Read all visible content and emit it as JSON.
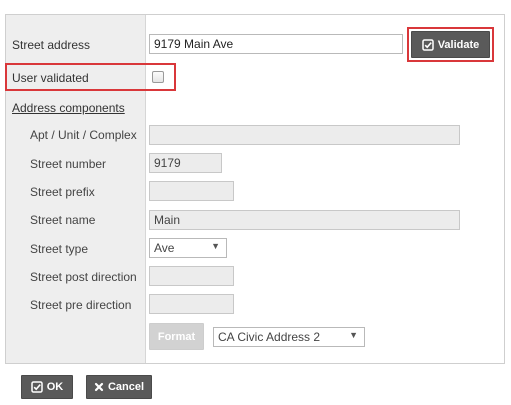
{
  "form": {
    "street_address": {
      "label": "Street address",
      "value": "9179 Main Ave"
    },
    "validate_button": {
      "label": "Validate",
      "icon": "check-square-icon"
    },
    "user_validated": {
      "label": "User validated",
      "checked": false
    },
    "address_components": {
      "heading": "Address components"
    },
    "fields": {
      "apt_unit": {
        "label": "Apt / Unit / Complex",
        "value": ""
      },
      "street_number": {
        "label": "Street number",
        "value": "9179"
      },
      "street_prefix": {
        "label": "Street prefix",
        "value": ""
      },
      "street_name": {
        "label": "Street name",
        "value": "Main"
      },
      "street_type": {
        "label": "Street type",
        "value": "Ave"
      },
      "street_post_direction": {
        "label": "Street post direction",
        "value": ""
      },
      "street_pre_direction": {
        "label": "Street pre direction",
        "value": ""
      }
    },
    "format_button": {
      "label": "Format"
    },
    "format_select": {
      "value": "CA Civic Address 2"
    }
  },
  "footer": {
    "ok_button": {
      "label": "OK",
      "icon": "check-square-icon"
    },
    "cancel_button": {
      "label": "Cancel",
      "icon": "close-icon"
    }
  },
  "colors": {
    "highlight": "#d9373a",
    "button_dark": "#5a5a5a",
    "button_disabled": "#d2d2d2"
  }
}
